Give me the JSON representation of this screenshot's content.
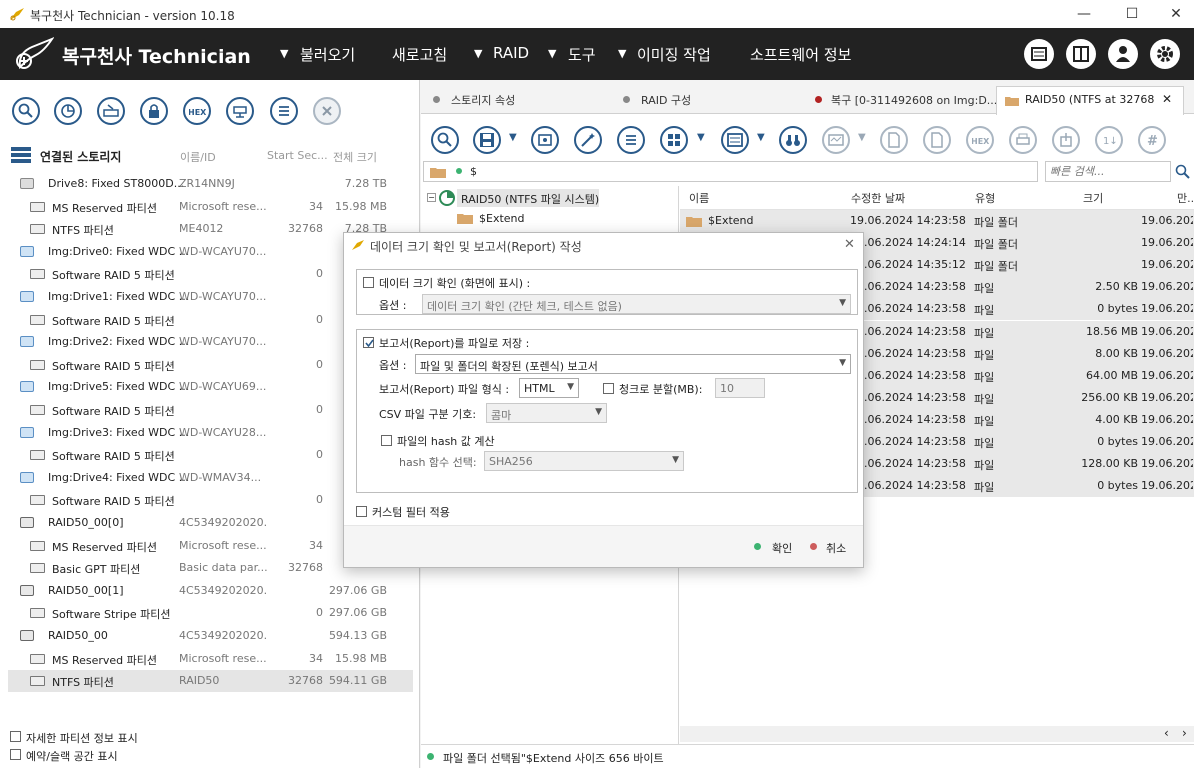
{
  "window": {
    "title": "복구천사 Technician - version 10.18",
    "min": "—",
    "max": "☐",
    "close": "✕"
  },
  "menu": {
    "brand": "복구천사 Technician",
    "items": [
      "불러오기",
      "새로고침",
      "RAID",
      "도구",
      "이미징 작업",
      "소프트웨어 정보"
    ],
    "arrows": [
      "▼",
      "▼",
      "▼"
    ]
  },
  "left": {
    "header": {
      "title": "연결된 스토리지",
      "col_id": "이름/ID",
      "col_start": "Start Sec...",
      "col_size": "전체 크기"
    },
    "rows": [
      {
        "name": "Drive8: Fixed ST8000D...",
        "id": "ZR14NN9J",
        "start": "",
        "size": "7.28 TB",
        "kind": "disk"
      },
      {
        "name": "MS Reserved 파티션",
        "id": "Microsoft rese...",
        "start": "34",
        "size": "15.98 MB",
        "kind": "part"
      },
      {
        "name": "NTFS 파티션",
        "id": "ME4012",
        "start": "32768",
        "size": "7.28 TB",
        "kind": "part"
      },
      {
        "name": "Img:Drive0: Fixed WDC ...",
        "id": "WD-WCAYU70...",
        "start": "",
        "size": "",
        "kind": "img"
      },
      {
        "name": "Software RAID 5 파티션",
        "id": "",
        "start": "0",
        "size": "",
        "kind": "part"
      },
      {
        "name": "Img:Drive1: Fixed WDC ...",
        "id": "WD-WCAYU70...",
        "start": "",
        "size": "",
        "kind": "img"
      },
      {
        "name": "Software RAID 5 파티션",
        "id": "",
        "start": "0",
        "size": "",
        "kind": "part"
      },
      {
        "name": "Img:Drive2: Fixed WDC ...",
        "id": "WD-WCAYU70...",
        "start": "",
        "size": "",
        "kind": "img"
      },
      {
        "name": "Software RAID 5 파티션",
        "id": "",
        "start": "0",
        "size": "",
        "kind": "part"
      },
      {
        "name": "Img:Drive5: Fixed WDC ...",
        "id": "WD-WCAYU69...",
        "start": "",
        "size": "",
        "kind": "img"
      },
      {
        "name": "Software RAID 5 파티션",
        "id": "",
        "start": "0",
        "size": "",
        "kind": "part"
      },
      {
        "name": "Img:Drive3: Fixed WDC ...",
        "id": "WD-WCAYU28...",
        "start": "",
        "size": "",
        "kind": "img"
      },
      {
        "name": "Software RAID 5 파티션",
        "id": "",
        "start": "0",
        "size": "",
        "kind": "part"
      },
      {
        "name": "Img:Drive4: Fixed WDC ...",
        "id": "WD-WMAV34...",
        "start": "",
        "size": "",
        "kind": "img"
      },
      {
        "name": "Software RAID 5 파티션",
        "id": "",
        "start": "0",
        "size": "",
        "kind": "part"
      },
      {
        "name": "RAID50_00[0]",
        "id": "4C5349202020...",
        "start": "",
        "size": "",
        "kind": "raid"
      },
      {
        "name": "MS Reserved 파티션",
        "id": "Microsoft rese...",
        "start": "34",
        "size": "",
        "kind": "part"
      },
      {
        "name": "Basic GPT 파티션",
        "id": "Basic data par...",
        "start": "32768",
        "size": "",
        "kind": "part"
      },
      {
        "name": "RAID50_00[1]",
        "id": "4C5349202020...",
        "start": "",
        "size": "297.06 GB",
        "kind": "raid"
      },
      {
        "name": "Software Stripe 파티션",
        "id": "",
        "start": "0",
        "size": "297.06 GB",
        "kind": "part"
      },
      {
        "name": "RAID50_00",
        "id": "4C5349202020...",
        "start": "",
        "size": "594.13 GB",
        "kind": "raid"
      },
      {
        "name": "MS Reserved 파티션",
        "id": "Microsoft rese...",
        "start": "34",
        "size": "15.98 MB",
        "kind": "part"
      },
      {
        "name": "NTFS 파티션",
        "id": "RAID50",
        "start": "32768",
        "size": "594.11 GB",
        "kind": "part"
      }
    ],
    "footer": {
      "detail_label": "자세한 파티션 정보 표시",
      "slack_label": "예약/슬랙 공간 표시"
    }
  },
  "right": {
    "tabs": [
      {
        "label": "스토리지 속성",
        "dot": "#888888"
      },
      {
        "label": "RAID 구성",
        "dot": "#888888"
      },
      {
        "label": "복구 [0-311492608 on Img:D...",
        "dot": "#b22222"
      },
      {
        "label": "RAID50 (NTFS at 32768 ...",
        "dot": ""
      }
    ],
    "tab_close": "✕",
    "path": "$",
    "search_placeholder": "빠른 검색...",
    "tree": {
      "root": "RAID50 (NTFS 파일 시스템)",
      "child": "$Extend"
    },
    "columns": {
      "name": "이름",
      "modified": "수정한 날짜",
      "type": "유형",
      "size": "크기",
      "created": "만..."
    },
    "files": [
      {
        "name": "$Extend",
        "modified": "19.06.2024 14:23:58",
        "type": "파일 폴더",
        "size": "",
        "created": "19.06.2024"
      },
      {
        "name": "",
        "modified": "19.06.2024 14:24:14",
        "type": "파일 폴더",
        "size": "",
        "created": "19.06.2024"
      },
      {
        "name": "",
        "modified": "19.06.2024 14:35:12",
        "type": "파일 폴더",
        "size": "",
        "created": "19.06.2024"
      },
      {
        "name": "",
        "modified": "19.06.2024 14:23:58",
        "type": "파일",
        "size": "2.50 KB",
        "created": "19.06.2024"
      },
      {
        "name": "",
        "modified": "19.06.2024 14:23:58",
        "type": "파일",
        "size": "0 bytes",
        "created": "19.06.2024"
      },
      {
        "name": "",
        "modified": "19.06.2024 14:23:58",
        "type": "파일",
        "size": "18.56 MB",
        "created": "19.06.2024"
      },
      {
        "name": "",
        "modified": "19.06.2024 14:23:58",
        "type": "파일",
        "size": "8.00 KB",
        "created": "19.06.2024"
      },
      {
        "name": "",
        "modified": "19.06.2024 14:23:58",
        "type": "파일",
        "size": "64.00 MB",
        "created": "19.06.2024"
      },
      {
        "name": "",
        "modified": "19.06.2024 14:23:58",
        "type": "파일",
        "size": "256.00 KB",
        "created": "19.06.2024"
      },
      {
        "name": "",
        "modified": "19.06.2024 14:23:58",
        "type": "파일",
        "size": "4.00 KB",
        "created": "19.06.2024"
      },
      {
        "name": "",
        "modified": "19.06.2024 14:23:58",
        "type": "파일",
        "size": "0 bytes",
        "created": "19.06.2024"
      },
      {
        "name": "",
        "modified": "19.06.2024 14:23:58",
        "type": "파일",
        "size": "128.00 KB",
        "created": "19.06.2024"
      },
      {
        "name": "",
        "modified": "19.06.2024 14:23:58",
        "type": "파일",
        "size": "0 bytes",
        "created": "19.06.2024"
      }
    ],
    "status": "파일 폴더 선택됨\"$Extend 사이즈 656 바이트"
  },
  "dialog": {
    "title": "데이터 크기 확인 및 보고서(Report) 작성",
    "check_section": {
      "label": "데이터 크기 확인 (화면에 표시) :",
      "option_label": "옵션 :",
      "option_value": "데이터 크기 확인 (간단 체크, 테스트 없음)"
    },
    "report_section": {
      "label": "보고서(Report)를 파일로 저장 :",
      "option_label": "옵션 :",
      "option_value": "파일 및 폴더의 확장된 (포렌식) 보고서",
      "format_label": "보고서(Report) 파일 형식 :",
      "format_value": "HTML",
      "chunk_label": "청크로 분할(MB):",
      "chunk_value": "10",
      "csv_label": "CSV 파일 구분 기호:",
      "csv_value": "콤마",
      "hash_label": "파일의 hash 값 계산",
      "hash_fn_label": "hash 함수 선택:",
      "hash_fn_value": "SHA256"
    },
    "filter_label": "커스텀 필터 적용",
    "ok": "확인",
    "cancel": "취소",
    "ok_color": "#3cb371",
    "cancel_color": "#cd5c5c"
  }
}
